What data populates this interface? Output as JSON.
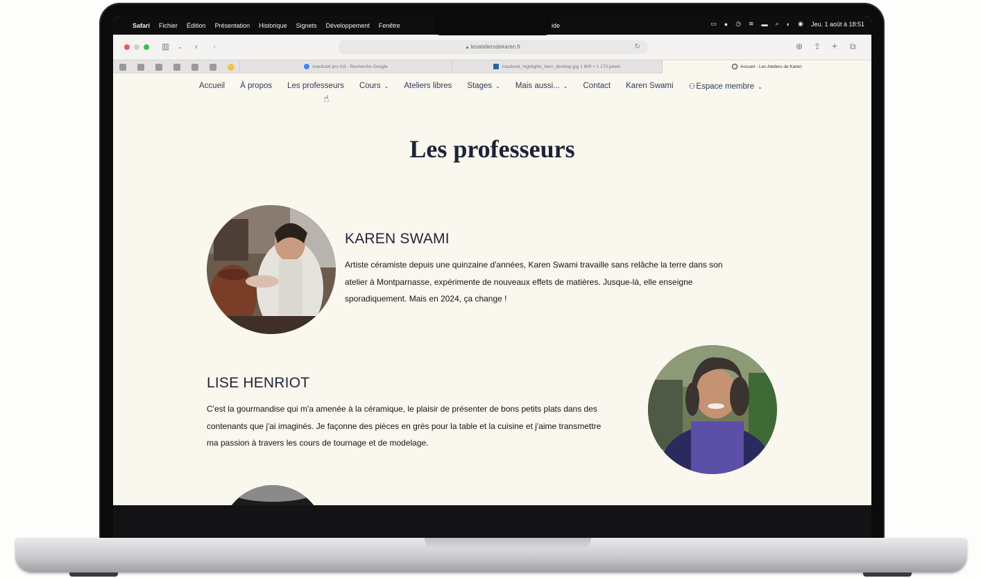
{
  "menubar": {
    "apple_icon": "apple-icon",
    "app_name": "Safari",
    "items": [
      "Fichier",
      "Édition",
      "Présentation",
      "Historique",
      "Signets",
      "Développement",
      "Fenêtre"
    ],
    "aide": "Aide",
    "clock": "Jeu. 1 août à 18:51"
  },
  "browser": {
    "address": "lesateliersdekaren.fr",
    "tabs": [
      "macbook pro m3 - Recherche Google",
      "macbook_highlights_hero_desktop.jpg 1 800 × 1 170 pixels",
      "Accueil - Les Ateliers de Karen"
    ]
  },
  "nav": {
    "items": [
      {
        "label": "Accueil"
      },
      {
        "label": "À propos"
      },
      {
        "label": "Les professeurs"
      },
      {
        "label": "Cours"
      },
      {
        "label": "Ateliers libres"
      },
      {
        "label": "Stages"
      },
      {
        "label": "Mais aussi..."
      },
      {
        "label": "Contact"
      },
      {
        "label": "Karen Swami"
      },
      {
        "label": "Espace membre"
      }
    ]
  },
  "page": {
    "title": "Les professeurs",
    "teachers": [
      {
        "name": "KAREN SWAMI",
        "bio_lines": [
          "Artiste céramiste depuis une quinzaine d'années, Karen Swami travaille sans relâche la terre dans son",
          "atelier à Montparnasse, expérimente de nouveaux effets de matières. Jusque-là, elle enseigne",
          "sporadiquement. Mais en 2024, ça change !"
        ]
      },
      {
        "name": "LISE HENRIOT",
        "bio_lines": [
          "C'est la gourmandise qui m'a amenée à la céramique, le plaisir de présenter de bons petits plats dans des",
          "contenants que j'ai imaginés. Je façonne des pièces en grès pour la table et la cuisine et j'aime transmettre",
          "ma passion à travers les cours de tournage et de modelage."
        ]
      }
    ]
  },
  "colors": {
    "site_bg": "#faf7ee",
    "nav_text": "#2d3a5a",
    "title": "#1d2336",
    "apron_purple": "#5b4fa8"
  }
}
